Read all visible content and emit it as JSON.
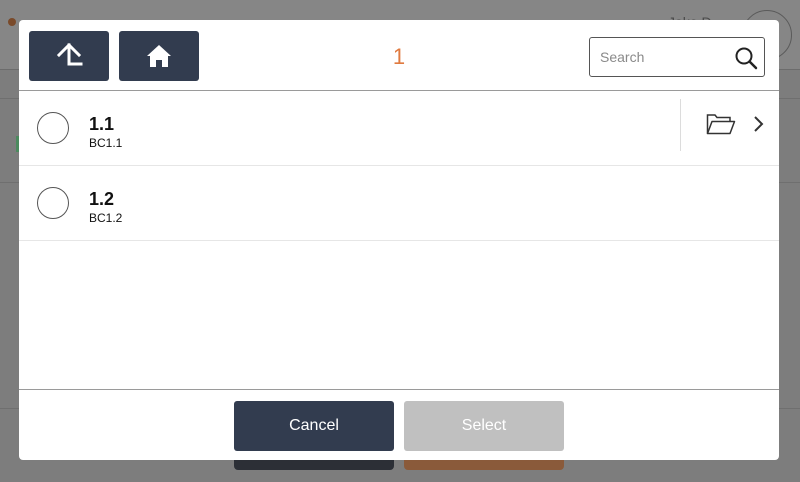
{
  "background": {
    "user_text": "Jako D"
  },
  "dialog": {
    "header": {
      "up_icon": "arrow-up-icon",
      "home_icon": "home-icon",
      "title": "1",
      "search_placeholder": "Search",
      "search_value": "",
      "search_icon": "search-icon"
    },
    "items": [
      {
        "name": "1.1",
        "code": "BC1.1",
        "has_children": true,
        "folder_icon": "folder-open-icon",
        "chevron_icon": "chevron-right-icon"
      },
      {
        "name": "1.2",
        "code": "BC1.2",
        "has_children": false
      }
    ],
    "footer": {
      "cancel_label": "Cancel",
      "select_label": "Select",
      "select_enabled": false
    }
  },
  "colors": {
    "primary_dark": "#323c4f",
    "accent_orange": "#e07a3f",
    "disabled_gray": "#c0c0c0"
  }
}
